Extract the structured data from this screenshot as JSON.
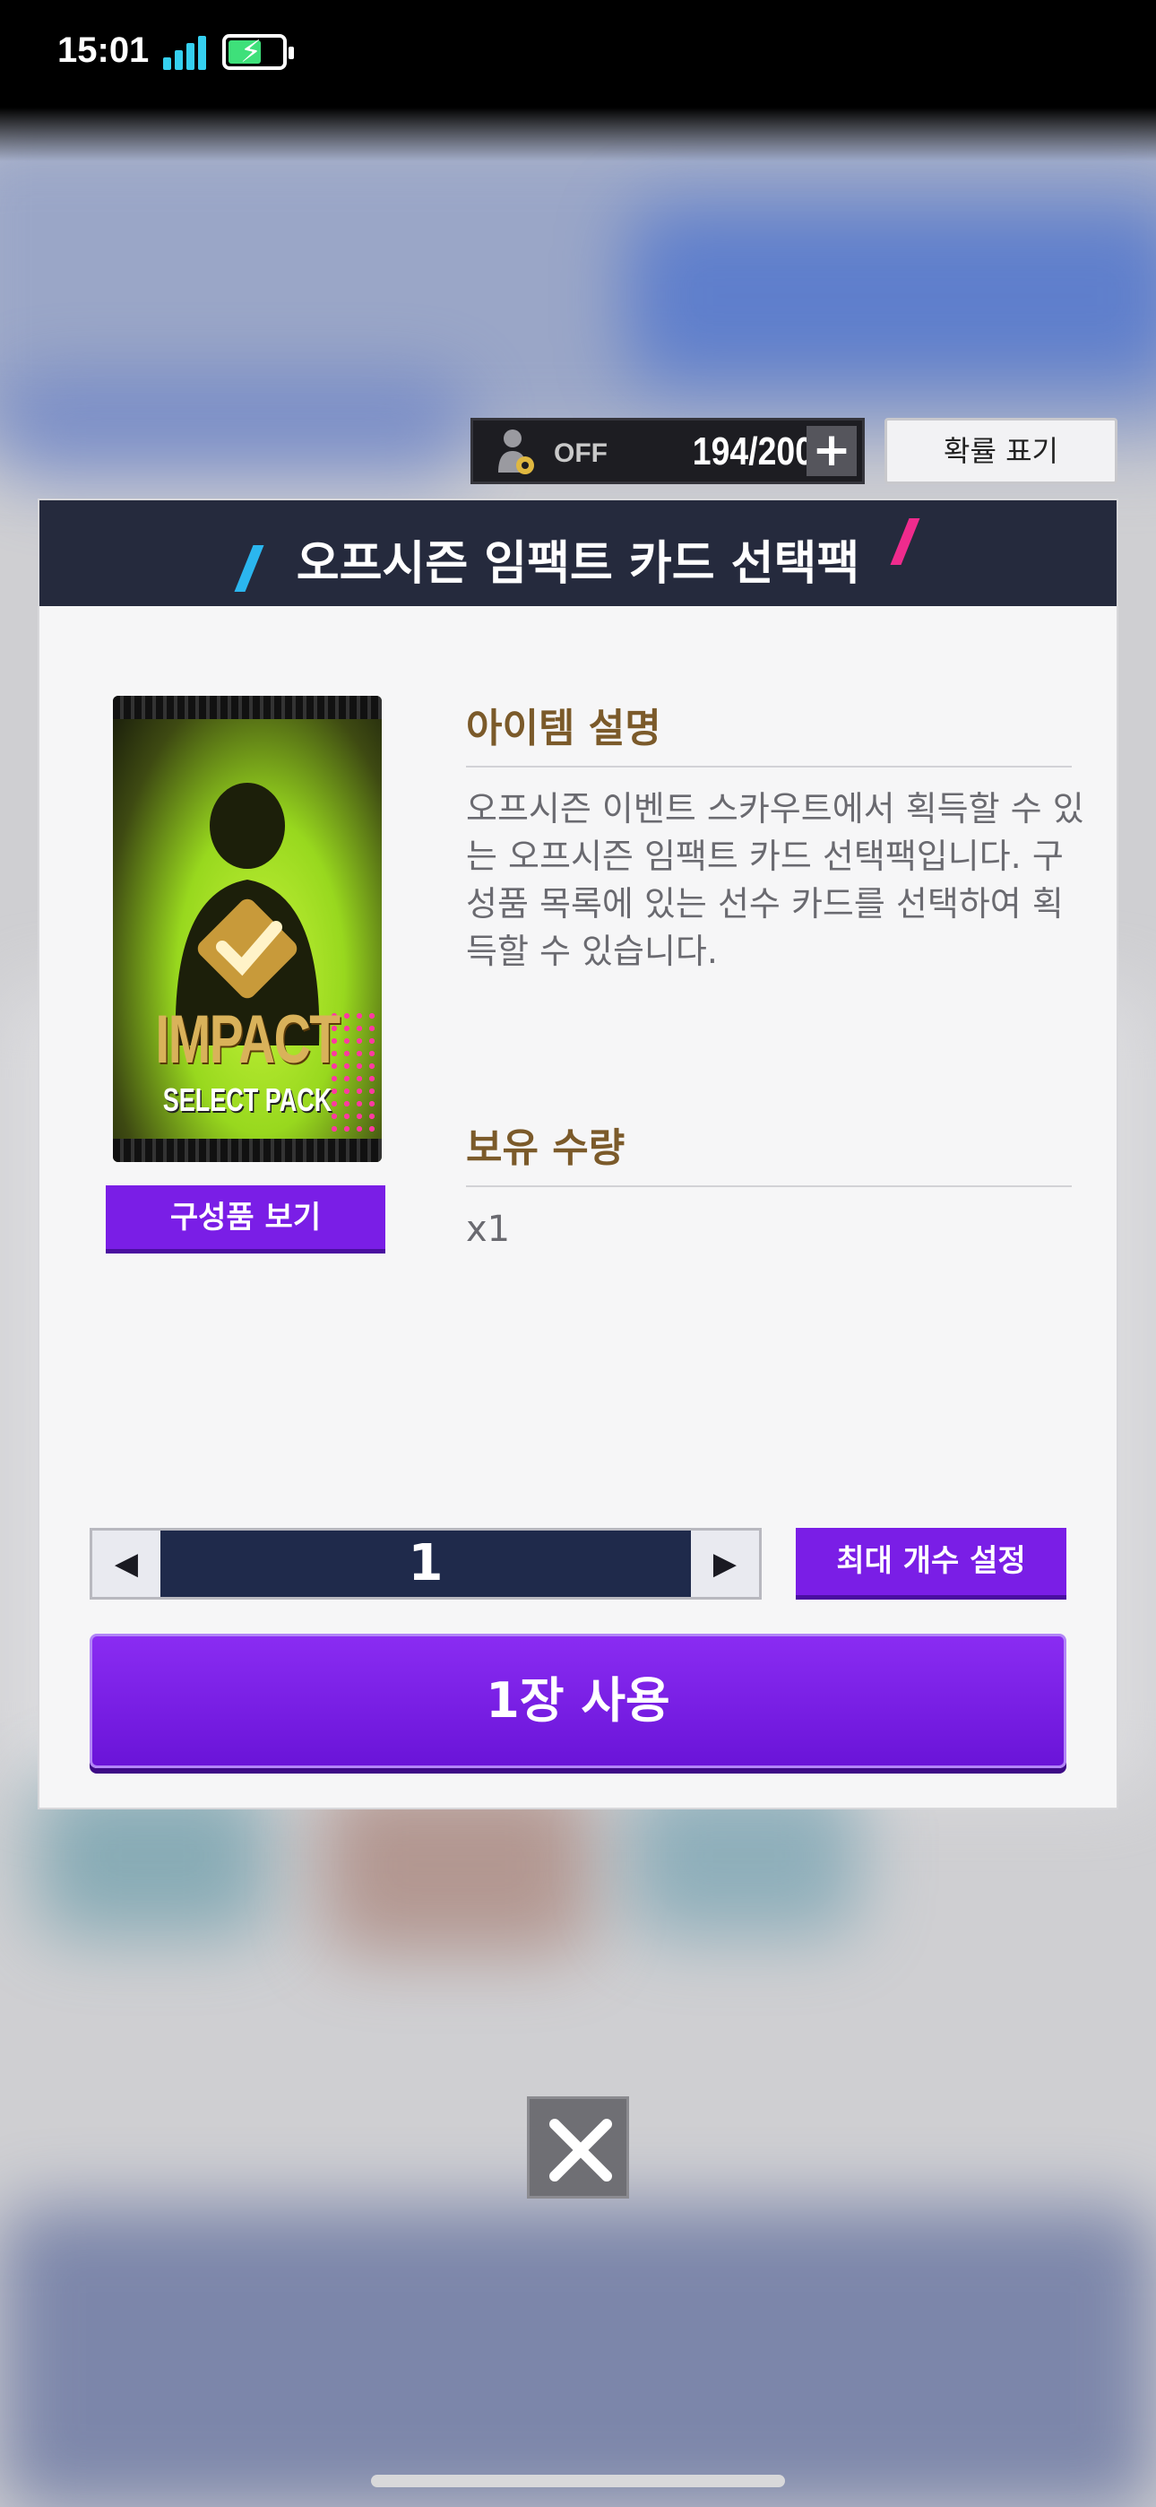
{
  "status_bar": {
    "time": "15:01"
  },
  "top_controls": {
    "auto_label": "OFF",
    "count": "194/200",
    "plus_label": "+",
    "probability_button": "확률 표기"
  },
  "modal": {
    "title": "오프시즌 임팩트 카드 선택팩",
    "pack_image": {
      "line1": "IMPACT",
      "line2": "SELECT PACK"
    },
    "contents_button": "구성품 보기",
    "description_heading": "아이템 설명",
    "description_text": "오프시즌 이벤트 스카우트에서 획득할 수 있는 오프시즌 임팩트 카드 선택팩입니다. 구성품 목록에 있는 선수 카드를 선택하여 획득할 수 있습니다.",
    "quantity_heading": "보유 수량",
    "quantity_value": "x1",
    "stepper": {
      "decrement": "◀",
      "value": "1",
      "increment": "▶"
    },
    "max_button": "최대 개수 설정",
    "use_button": "1장 사용"
  },
  "colors": {
    "header_bg": "#252a3d",
    "accent_purple": "#7a1ee6",
    "heading_brown": "#7b5a2a"
  },
  "icons": [
    "signal-icon",
    "battery-icon",
    "auto-player-gear-icon",
    "checkmark-icon",
    "close-icon"
  ]
}
